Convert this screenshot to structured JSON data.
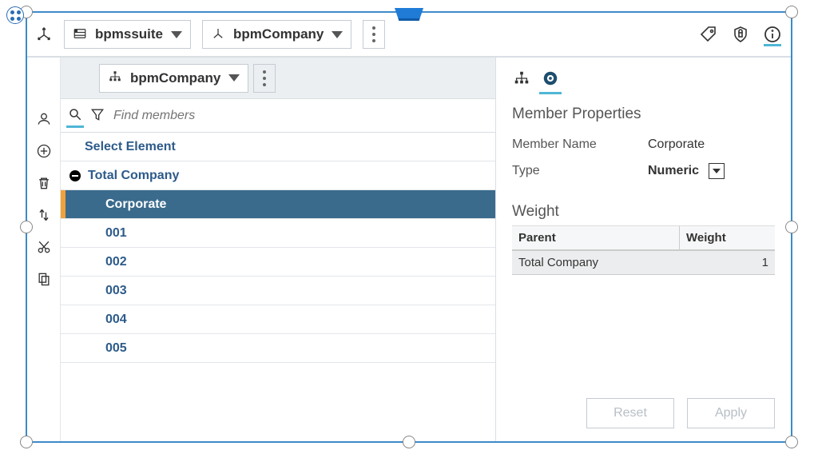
{
  "topbar": {
    "dropdown1": {
      "label": "bpmssuite"
    },
    "dropdown2": {
      "label": "bpmCompany"
    }
  },
  "subtoolbar": {
    "dropdown": {
      "label": "bpmCompany"
    }
  },
  "search": {
    "placeholder": "Find members"
  },
  "list": {
    "select_label": "Select Element",
    "root": "Total Company",
    "items": [
      {
        "label": "Corporate",
        "selected": true
      },
      {
        "label": "001"
      },
      {
        "label": "002"
      },
      {
        "label": "003"
      },
      {
        "label": "004"
      },
      {
        "label": "005"
      }
    ]
  },
  "properties": {
    "title": "Member Properties",
    "name_label": "Member Name",
    "name_value": "Corporate",
    "type_label": "Type",
    "type_value": "Numeric",
    "weight_heading": "Weight",
    "table": {
      "headers": [
        "Parent",
        "Weight"
      ],
      "rows": [
        {
          "parent": "Total Company",
          "weight": "1"
        }
      ]
    },
    "reset_label": "Reset",
    "apply_label": "Apply"
  }
}
